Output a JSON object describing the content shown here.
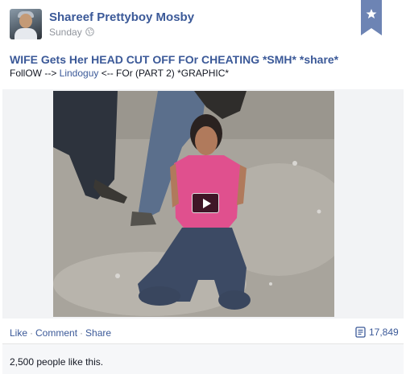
{
  "post": {
    "author": "Shareef Prettyboy Mosby",
    "timestamp": "Sunday",
    "privacy_icon": "globe-icon",
    "bookmark_icon": "star-icon",
    "headline": "WIFE Gets Her HEAD CUT OFF FOr CHEATING *SMH* *share*",
    "subline_before": "FollOW --> ",
    "subline_link": "Lindoguy",
    "subline_after": " <-- FOr (PART 2) *GRAPHIC*"
  },
  "video": {
    "play_icon": "play-icon"
  },
  "actions": {
    "like": "Like",
    "comment": "Comment",
    "share": "Share",
    "separator": "·",
    "views": "17,849",
    "views_icon": "views-icon"
  },
  "likes": {
    "text": "2,500 people like this."
  },
  "colors": {
    "link": "#3b5998",
    "muted": "#90949c",
    "bookmark": "#6d84b4"
  }
}
